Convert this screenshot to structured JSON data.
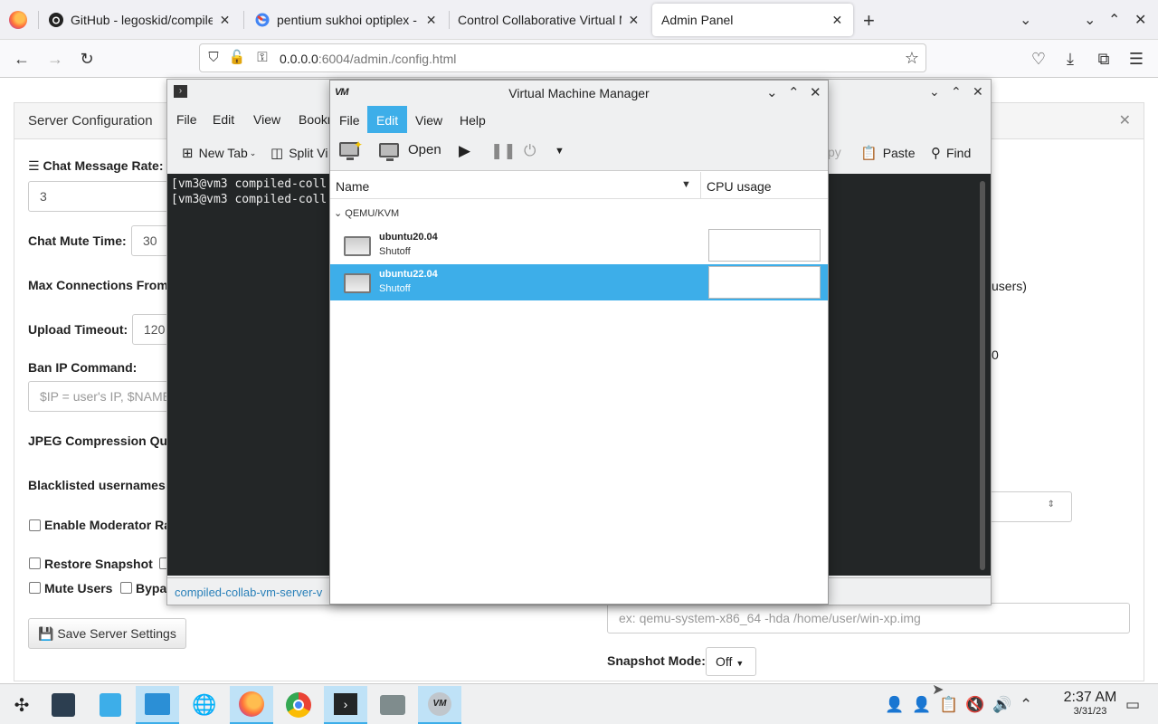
{
  "browser": {
    "tabs": [
      {
        "label": "GitHub - legoskid/compile",
        "icon": "github-icon"
      },
      {
        "label": "pentium sukhoi optiplex - G",
        "icon": "google-icon"
      },
      {
        "label": "Control Collaborative Virtual M",
        "icon": "none"
      },
      {
        "label": "Admin Panel",
        "icon": "none"
      }
    ],
    "url_host": "0.0.0.0",
    "url_rest": ":6004/admin./config.html"
  },
  "config": {
    "header": "Server Configuration",
    "chat_rate_label": "Chat Message Rate:",
    "chat_rate_value": "3",
    "chat_mute_label": "Chat Mute Time:",
    "chat_mute_value": "30",
    "max_conn_label": "Max Connections From",
    "upload_timeout_label": "Upload Timeout:",
    "upload_timeout_value": "120",
    "ban_ip_label": "Ban IP Command:",
    "ban_ip_placeholder": "$IP = user's IP, $NAME",
    "jpeg_label": "JPEG Compression Qu",
    "blacklist_label": "Blacklisted usernames",
    "enable_mod_label": "Enable Moderator Ra",
    "restore_snapshot_label": "Restore Snapshot",
    "mute_users_label": "Mute Users",
    "bypass_label": "Bypa",
    "save_button": "Save Server Settings",
    "right_users_fragment": "users)",
    "right_zero_fragment": "0",
    "qemu_placeholder": "ex: qemu-system-x86_64 -hda /home/user/win-xp.img",
    "snapshot_mode_label": "Snapshot Mode:",
    "snapshot_mode_value": "Off"
  },
  "konsole": {
    "menu": [
      "File",
      "Edit",
      "View",
      "Bookm"
    ],
    "toolbar": {
      "new_tab": "New Tab",
      "split_view": "Split Vi",
      "copy": "py",
      "paste": "Paste",
      "find": "Find"
    },
    "lines": [
      "[vm3@vm3 compiled-coll",
      "[vm3@vm3 compiled-coll"
    ],
    "tab_label": "compiled-collab-vm-server-v"
  },
  "vmm": {
    "title": "Virtual Machine Manager",
    "logo": "VM",
    "menu": [
      "File",
      "Edit",
      "View",
      "Help"
    ],
    "active_menu": "Edit",
    "open_label": "Open",
    "col_name": "Name",
    "col_cpu": "CPU usage",
    "group": "QEMU/KVM",
    "vms": [
      {
        "name": "ubuntu20.04",
        "state": "Shutoff"
      },
      {
        "name": "ubuntu22.04",
        "state": "Shutoff"
      }
    ]
  },
  "taskbar": {
    "time": "2:37 AM",
    "date": "3/31/23"
  },
  "colors": {
    "accent": "#3daee9",
    "terminal_bg": "#232627"
  }
}
